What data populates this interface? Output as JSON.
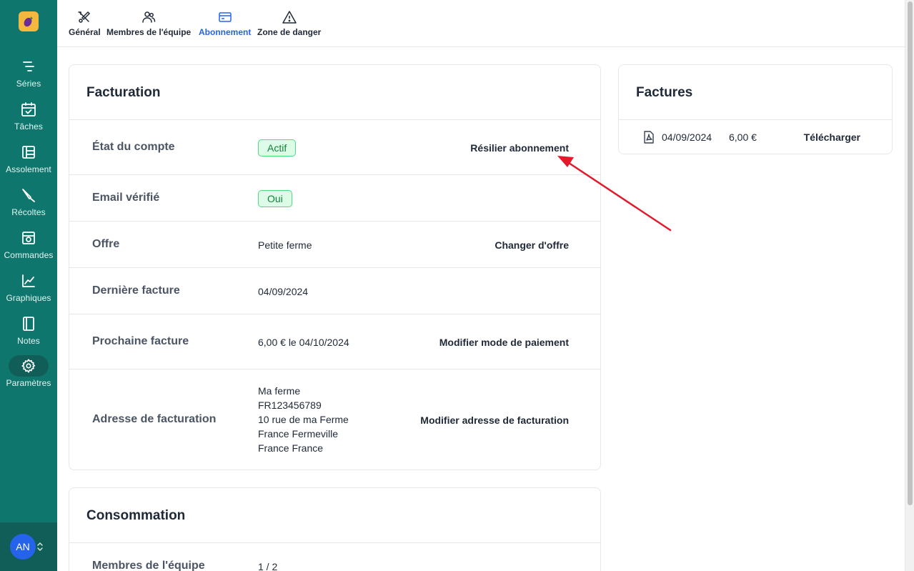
{
  "sidebar": {
    "items": [
      {
        "label": "Séries",
        "icon": "series-icon"
      },
      {
        "label": "Tâches",
        "icon": "calendar-check-icon"
      },
      {
        "label": "Assolement",
        "icon": "layout-icon"
      },
      {
        "label": "Récoltes",
        "icon": "knife-icon"
      },
      {
        "label": "Commandes",
        "icon": "basket-icon"
      },
      {
        "label": "Graphiques",
        "icon": "line-chart-icon"
      },
      {
        "label": "Notes",
        "icon": "notebook-icon"
      },
      {
        "label": "Paramètres",
        "icon": "gear-icon"
      }
    ],
    "user_initials": "AN"
  },
  "tabs": [
    {
      "label": "Général",
      "icon": "tools-icon"
    },
    {
      "label": "Membres de l'équipe",
      "icon": "users-icon"
    },
    {
      "label": "Abonnement",
      "icon": "credit-card-icon"
    },
    {
      "label": "Zone de danger",
      "icon": "warning-icon"
    }
  ],
  "billing": {
    "title": "Facturation",
    "account_status_label": "État du compte",
    "account_status_value": "Actif",
    "cancel_action": "Résilier abonnement",
    "email_verified_label": "Email vérifié",
    "email_verified_value": "Oui",
    "plan_label": "Offre",
    "plan_value": "Petite ferme",
    "change_plan_action": "Changer d'offre",
    "last_invoice_label": "Dernière facture",
    "last_invoice_value": "04/09/2024",
    "next_invoice_label": "Prochaine facture",
    "next_invoice_value": "6,00 € le 04/10/2024",
    "payment_method_action": "Modifier mode de paiement",
    "address_label": "Adresse de facturation",
    "address_lines": [
      "Ma ferme",
      "FR123456789",
      "10 rue de ma Ferme",
      "France Fermeville",
      "France France"
    ],
    "address_action": "Modifier adresse de facturation"
  },
  "consumption": {
    "title": "Consommation",
    "team_members_label": "Membres de l'équipe",
    "team_members_value": "1 / 2"
  },
  "invoices": {
    "title": "Factures",
    "items": [
      {
        "date": "04/09/2024",
        "amount": "6,00 €",
        "action": "Télécharger"
      }
    ]
  },
  "colors": {
    "sidebar": "#0f766e",
    "accent": "#2563eb",
    "badge_green": "#15803d",
    "arrow_red": "#e3192c"
  }
}
